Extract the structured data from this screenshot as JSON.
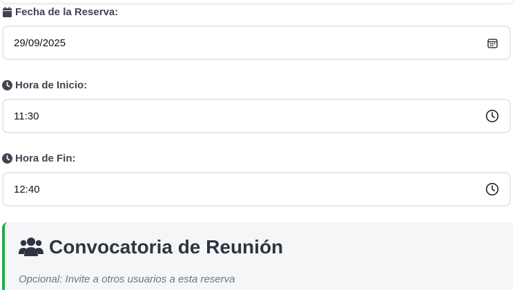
{
  "fields": {
    "date": {
      "label": "Fecha de la Reserva:",
      "value": "29/09/2025",
      "icon": "calendar-icon",
      "picker_icon": "calendar-picker-icon"
    },
    "start": {
      "label": "Hora de Inicio:",
      "value": "11:30",
      "icon": "clock-icon",
      "picker_icon": "clock-picker-icon"
    },
    "end": {
      "label": "Hora de Fin:",
      "value": "12:40",
      "icon": "clock-icon",
      "picker_icon": "clock-picker-icon"
    }
  },
  "meeting": {
    "title": "Convocatoria de Reunión",
    "subtitle": "Opcional: Invite a otros usuarios a esta reserva",
    "icon": "users-icon"
  },
  "colors": {
    "accent_green": "#28a745",
    "label_text": "#3f4450",
    "border": "#e6e8eb",
    "card_bg": "#f5f6f8"
  }
}
